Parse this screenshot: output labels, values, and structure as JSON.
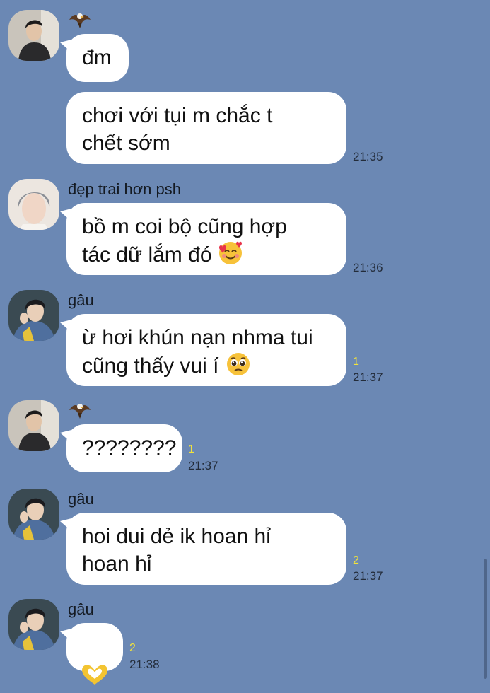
{
  "colors": {
    "background": "#6b88b4",
    "bubble": "#ffffff",
    "unread": "#f2e33a",
    "timestamp": "#232c3a"
  },
  "messages": [
    {
      "sender_icon": "eagle-icon",
      "lines": [
        {
          "text": "đm",
          "time": ""
        },
        {
          "text": "chơi với tụi m chắc t\nchết sớm",
          "time": "21:35"
        }
      ]
    },
    {
      "sender": "đẹp trai hơn psh",
      "text": "bồ m coi bộ cũng hợp\ntác dữ lắm đó",
      "emoji": "smiling-face-with-hearts-icon",
      "time": "21:36"
    },
    {
      "sender": "gâu",
      "text": "ừ hơi khún nạn nhma tui\ncũng thấy vui í",
      "emoji": "pleading-face-icon",
      "unread": "1",
      "time": "21:37"
    },
    {
      "sender_icon": "eagle-icon",
      "text": "????????",
      "unread": "1",
      "time": "21:37"
    },
    {
      "sender": "gâu",
      "text": "hoi dui dẻ ik hoan hỉ\nhoan hỉ",
      "unread": "2",
      "time": "21:37"
    },
    {
      "sender": "gâu",
      "sticker": "heart-hands-icon",
      "unread": "2",
      "time": "21:38"
    }
  ]
}
